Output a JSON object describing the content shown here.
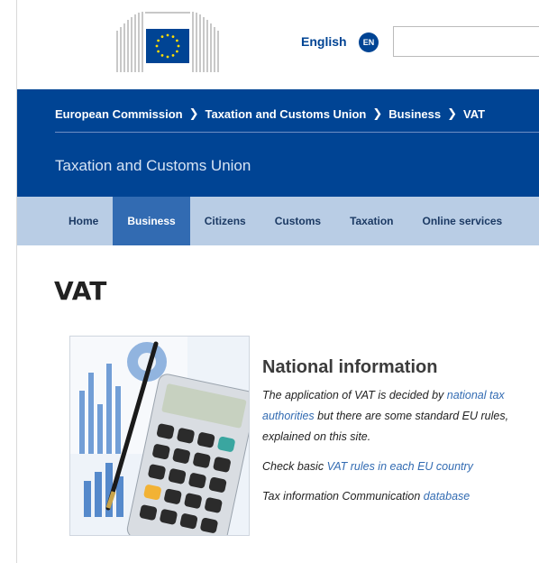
{
  "header": {
    "language_label": "English",
    "language_code": "EN",
    "search_value": "",
    "search_placeholder": ""
  },
  "breadcrumb": [
    {
      "label": "European Commission"
    },
    {
      "label": "Taxation and Customs Union"
    },
    {
      "label": "Business"
    },
    {
      "label": "VAT"
    }
  ],
  "site_title": "Taxation and Customs Union",
  "nav": {
    "items": [
      {
        "label": "Home"
      },
      {
        "label": "Business"
      },
      {
        "label": "Citizens"
      },
      {
        "label": "Customs"
      },
      {
        "label": "Taxation"
      },
      {
        "label": "Online services"
      }
    ],
    "active": "Business"
  },
  "main": {
    "page_title": "VAT",
    "section_title": "National information",
    "p1_before": "The application of VAT is decided by ",
    "p1_link": "national tax authorities",
    "p1_after": " but there are some standard EU rules, explained on this site.",
    "p2_before": "Check basic ",
    "p2_link": "VAT rules in each EU country",
    "p3_before": "Tax information Communication ",
    "p3_link": "database"
  },
  "colors": {
    "brand_blue": "#004494",
    "nav_bg": "#b9cde5",
    "nav_active": "#326bb2",
    "link": "#326bb2"
  },
  "icons": {
    "logo": "european-commission-logo",
    "language": "language-badge-icon",
    "thumbnail": "calculator-image"
  }
}
